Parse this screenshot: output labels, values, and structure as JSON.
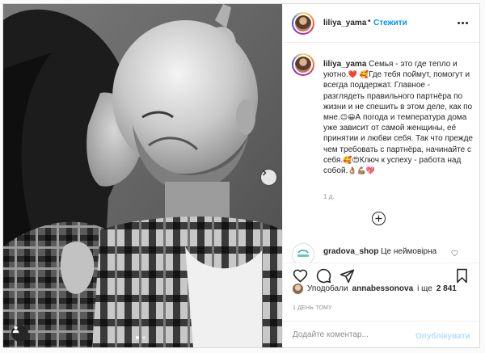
{
  "post": {
    "username": "liliya_yama",
    "separator": "•",
    "follow_label": "Стежити",
    "more_icon": "more-horizontal-icon"
  },
  "caption": {
    "username": "liliya_yama",
    "text_1": "Семья - это где тепло и уютно.",
    "text_2": "Где тебя поймут, помогут и всегда поддержат. Главное - разглядеть правильного партнёра по жизни и не спешить в этом деле, как по мне.",
    "text_3": "А погода и температура дома уже зависит от самой женщины, её принятии и любви себя. Так что прежде чем требовать с партнёра, начинайте с себя.",
    "text_4": "Ключ к успеху - работа над собой.",
    "emoji_1": "❤️",
    "emoji_2": "🥰",
    "emoji_3": "😉😀",
    "emoji_4": "🥰😍",
    "emoji_5": "👌🏽💪🏽💖",
    "time": "1 д."
  },
  "comment": {
    "username": "gradova_shop",
    "text": "Це неймовірна"
  },
  "likes": {
    "prefix": "Уподобали",
    "user": "annabessonova",
    "middle": "і ще",
    "count": "2 841"
  },
  "date": "1 ДЕНЬ ТОМУ",
  "composer": {
    "placeholder": "Додайте коментар...",
    "publish_label": "Опублікувати"
  },
  "colors": {
    "accent": "#0095f6",
    "publish_disabled": "#b2dffc",
    "heart": "#ed4956"
  },
  "carousel": {
    "slides": 2,
    "active": 1
  }
}
